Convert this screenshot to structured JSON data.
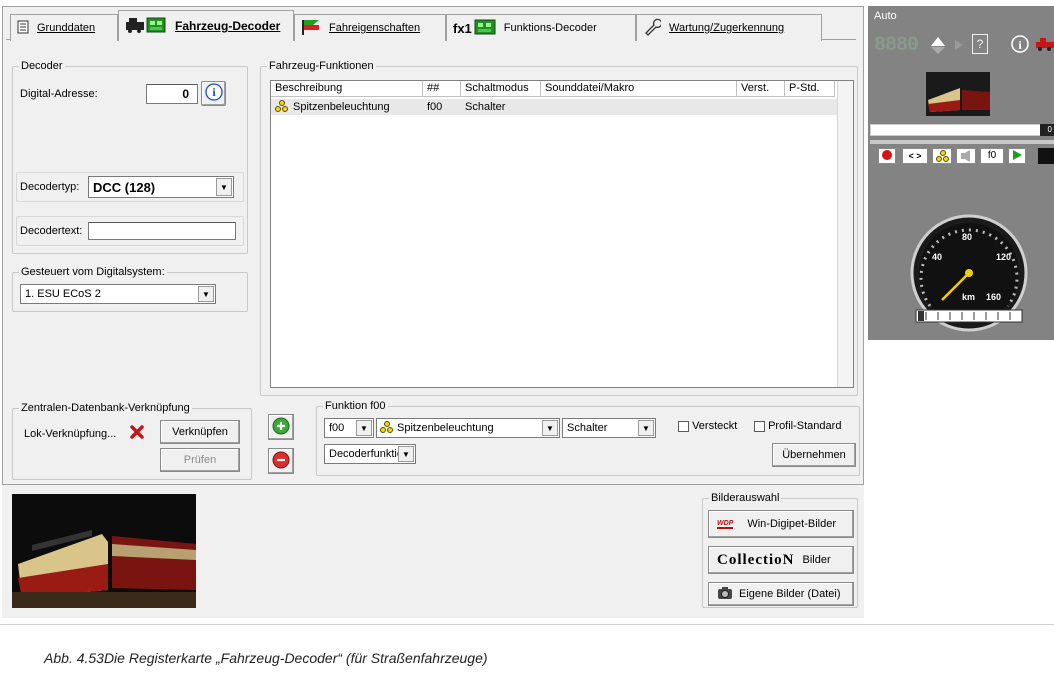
{
  "tabs": [
    {
      "label": "Grunddaten",
      "icon": "document-icon"
    },
    {
      "label": "Fahrzeug-Decoder",
      "icon": "locomotive-decoder-icon",
      "active": true
    },
    {
      "label": "Fahreigenschaften",
      "icon": "flag-icon"
    },
    {
      "label": "Funktions-Decoder",
      "icon": "fx1-decoder-icon",
      "prefix": "fx1"
    },
    {
      "label": "Wartung/Zugerkennung",
      "icon": "wrench-icon"
    }
  ],
  "decoder": {
    "legend": "Decoder",
    "address_label": "Digital-Adresse:",
    "address_value": "0",
    "type_label": "Decodertyp:",
    "type_value": "DCC (128)",
    "text_label": "Decodertext:",
    "text_value": ""
  },
  "digital_system": {
    "legend": "Gesteuert vom Digitalsystem:",
    "value": "1. ESU ECoS 2"
  },
  "db_link": {
    "legend": "Zentralen-Datenbank-Verknüpfung",
    "label": "Lok-Verknüpfung...",
    "link_button": "Verknüpfen",
    "check_button": "Prüfen"
  },
  "functions": {
    "legend": "Fahrzeug-Funktionen",
    "columns": [
      "Beschreibung",
      "##",
      "Schaltmodus",
      "Sounddatei/Makro",
      "Verst.",
      "P-Std."
    ],
    "rows": [
      {
        "beschreibung": "Spitzenbeleuchtung",
        "nr": "f00",
        "modus": "Schalter",
        "sound": "",
        "verst": "",
        "pstd": ""
      }
    ]
  },
  "function_edit": {
    "legend": "Funktion f00",
    "number": "f00",
    "name": "Spitzenbeleuchtung",
    "mode": "Schalter",
    "hidden_label": "Versteckt",
    "profile_label": "Profil-Standard",
    "type": "Decoderfunktion",
    "apply_button": "Übernehmen"
  },
  "images": {
    "legend": "Bilderauswahl",
    "wdp_button": "Win-Digipet-Bilder",
    "wdp_logo": "WDP",
    "collection_logo": "CollectioN",
    "collection_button": "Bilder",
    "own_button": "Eigene Bilder (Datei)"
  },
  "side_panel": {
    "title": "Auto",
    "address_display": "8880",
    "slider_value": "0",
    "buttons": [
      "< >",
      "f0"
    ],
    "speedo_ticks": [
      "40",
      "80",
      "120",
      "160"
    ],
    "speedo_unit": "km"
  },
  "caption": "Abb. 4.53Die Registerkarte „Fahrzeug-Decoder“ (für Straßenfahrzeuge)"
}
